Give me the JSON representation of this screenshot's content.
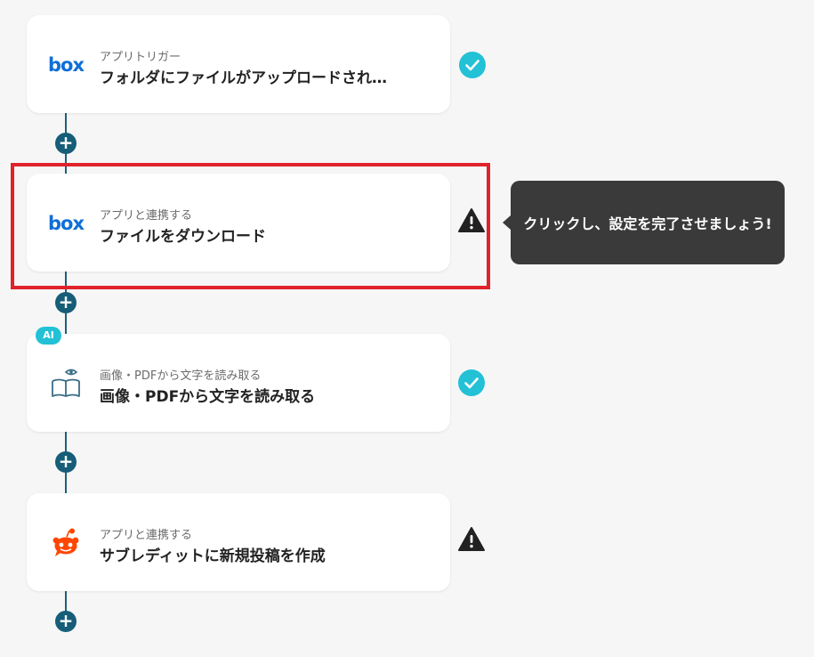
{
  "colors": {
    "connector": "#1f5f7a",
    "plus_button": "#165d78",
    "check_circle": "#22c1d6",
    "warning": "#222222",
    "highlight": "#e0232b",
    "tooltip_bg": "#3a3a3a",
    "box_blue": "#0f6fd7",
    "reddit_orange": "#ff4500"
  },
  "flow": {
    "plus_label": "+",
    "steps": [
      {
        "icon": "box-logo-icon",
        "logo_text": "box",
        "subtitle": "アプリトリガー",
        "title": "フォルダにファイルがアップロードされ…",
        "status": "complete"
      },
      {
        "icon": "box-logo-icon",
        "logo_text": "box",
        "subtitle": "アプリと連携する",
        "title": "ファイルをダウンロード",
        "status": "warning"
      },
      {
        "icon": "book-eye-icon",
        "badge": "AI",
        "subtitle": "画像・PDFから文字を読み取る",
        "title": "画像・PDFから文字を読み取る",
        "status": "complete"
      },
      {
        "icon": "reddit-icon",
        "subtitle": "アプリと連携する",
        "title": "サブレディットに新規投稿を作成",
        "status": "warning"
      }
    ]
  },
  "tooltip": {
    "text": "クリックし、設定を完了させましょう!"
  }
}
